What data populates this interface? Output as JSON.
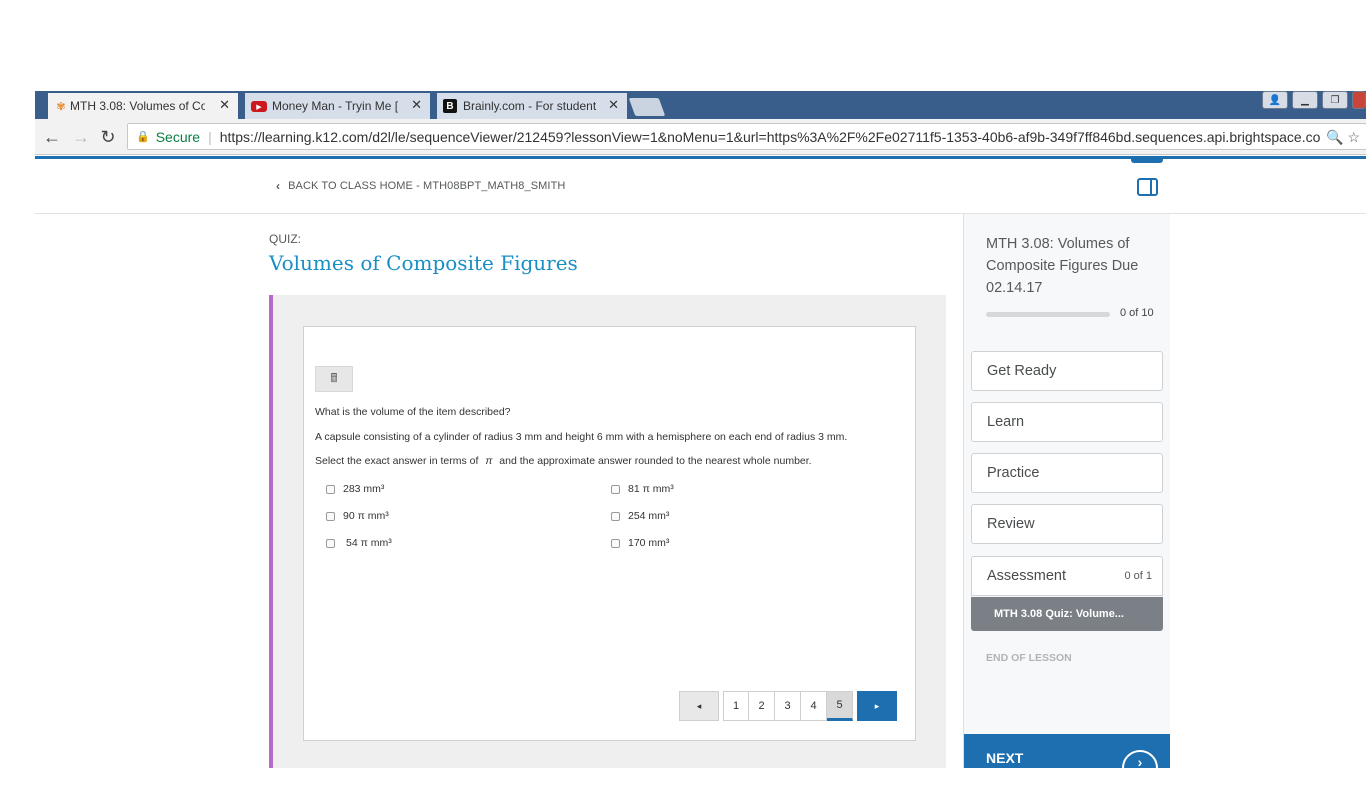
{
  "browser": {
    "tabs": [
      {
        "title": "MTH 3.08: Volumes of Co",
        "favicon": "flower-icon",
        "close": "✕"
      },
      {
        "title": "Money Man - Tryin Me [",
        "favicon": "youtube-icon",
        "close": "✕"
      },
      {
        "title": "Brainly.com - For student",
        "favicon": "brainly-icon",
        "close": "✕"
      }
    ],
    "secure_label": "Secure",
    "url": "https://learning.k12.com/d2l/le/sequenceViewer/212459?lessonView=1&noMenu=1&url=https%3A%2F%2Fe02711f5-1353-40b6-af9b-349f7ff846bd.sequences.api.brightspace.co"
  },
  "header": {
    "back_link": "BACK TO CLASS HOME - MTH08BPT_MATH8_SMITH"
  },
  "quiz": {
    "label": "QUIZ:",
    "title": "Volumes of Composite Figures",
    "question": "What is the volume of the item described?",
    "description": "A capsule consisting of a cylinder of radius 3 mm and height 6 mm with a hemisphere on each end of radius 3 mm.",
    "instruction_pre": "Select the exact answer in terms of",
    "instruction_pi": "π",
    "instruction_post": "and the approximate answer rounded to the nearest whole number.",
    "options": [
      {
        "label": "283 mm³"
      },
      {
        "label": "81 π mm³"
      },
      {
        "label": "90 π mm³"
      },
      {
        "label": "254 mm³"
      },
      {
        "label": "54 π mm³"
      },
      {
        "label": "170 mm³"
      }
    ],
    "pager": {
      "prev": "◂",
      "pages": [
        "1",
        "2",
        "3",
        "4",
        "5"
      ],
      "current_page": "5",
      "next": "▸"
    }
  },
  "sidebar": {
    "lesson_title": "MTH 3.08: Volumes of Composite Figures Due 02.14.17",
    "progress_text": "0 of 10",
    "progress_fraction": 0,
    "sections": [
      {
        "label": "Get Ready"
      },
      {
        "label": "Learn"
      },
      {
        "label": "Practice"
      },
      {
        "label": "Review"
      },
      {
        "label": "Assessment",
        "count": "0 of 1"
      }
    ],
    "active_item": "MTH 3.08 Quiz: Volume...",
    "end_of_lesson": "END OF LESSON",
    "next_label": "NEXT"
  }
}
